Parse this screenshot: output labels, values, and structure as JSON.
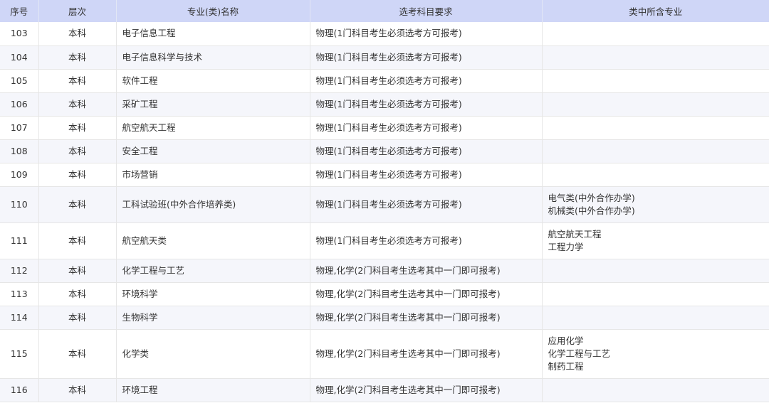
{
  "headers": [
    "序号",
    "层次",
    "专业(类)名称",
    "选考科目要求",
    "类中所含专业"
  ],
  "rows": [
    {
      "no": "103",
      "level": "本科",
      "major": "电子信息工程",
      "req": "物理(1门科目考生必须选考方可报考)",
      "sub": []
    },
    {
      "no": "104",
      "level": "本科",
      "major": "电子信息科学与技术",
      "req": "物理(1门科目考生必须选考方可报考)",
      "sub": []
    },
    {
      "no": "105",
      "level": "本科",
      "major": "软件工程",
      "req": "物理(1门科目考生必须选考方可报考)",
      "sub": []
    },
    {
      "no": "106",
      "level": "本科",
      "major": "采矿工程",
      "req": "物理(1门科目考生必须选考方可报考)",
      "sub": []
    },
    {
      "no": "107",
      "level": "本科",
      "major": "航空航天工程",
      "req": "物理(1门科目考生必须选考方可报考)",
      "sub": []
    },
    {
      "no": "108",
      "level": "本科",
      "major": "安全工程",
      "req": "物理(1门科目考生必须选考方可报考)",
      "sub": []
    },
    {
      "no": "109",
      "level": "本科",
      "major": "市场营销",
      "req": "物理(1门科目考生必须选考方可报考)",
      "sub": []
    },
    {
      "no": "110",
      "level": "本科",
      "major": "工科试验班(中外合作培养类)",
      "req": "物理(1门科目考生必须选考方可报考)",
      "sub": [
        "电气类(中外合作办学)",
        "机械类(中外合作办学)"
      ]
    },
    {
      "no": "111",
      "level": "本科",
      "major": "航空航天类",
      "req": "物理(1门科目考生必须选考方可报考)",
      "sub": [
        "航空航天工程",
        "工程力学"
      ]
    },
    {
      "no": "112",
      "level": "本科",
      "major": "化学工程与工艺",
      "req": "物理,化学(2门科目考生选考其中一门即可报考)",
      "sub": []
    },
    {
      "no": "113",
      "level": "本科",
      "major": "环境科学",
      "req": "物理,化学(2门科目考生选考其中一门即可报考)",
      "sub": []
    },
    {
      "no": "114",
      "level": "本科",
      "major": "生物科学",
      "req": "物理,化学(2门科目考生选考其中一门即可报考)",
      "sub": []
    },
    {
      "no": "115",
      "level": "本科",
      "major": "化学类",
      "req": "物理,化学(2门科目考生选考其中一门即可报考)",
      "sub": [
        "应用化学",
        "化学工程与工艺",
        "制药工程"
      ]
    },
    {
      "no": "116",
      "level": "本科",
      "major": "环境工程",
      "req": "物理,化学(2门科目考生选考其中一门即可报考)",
      "sub": []
    }
  ]
}
